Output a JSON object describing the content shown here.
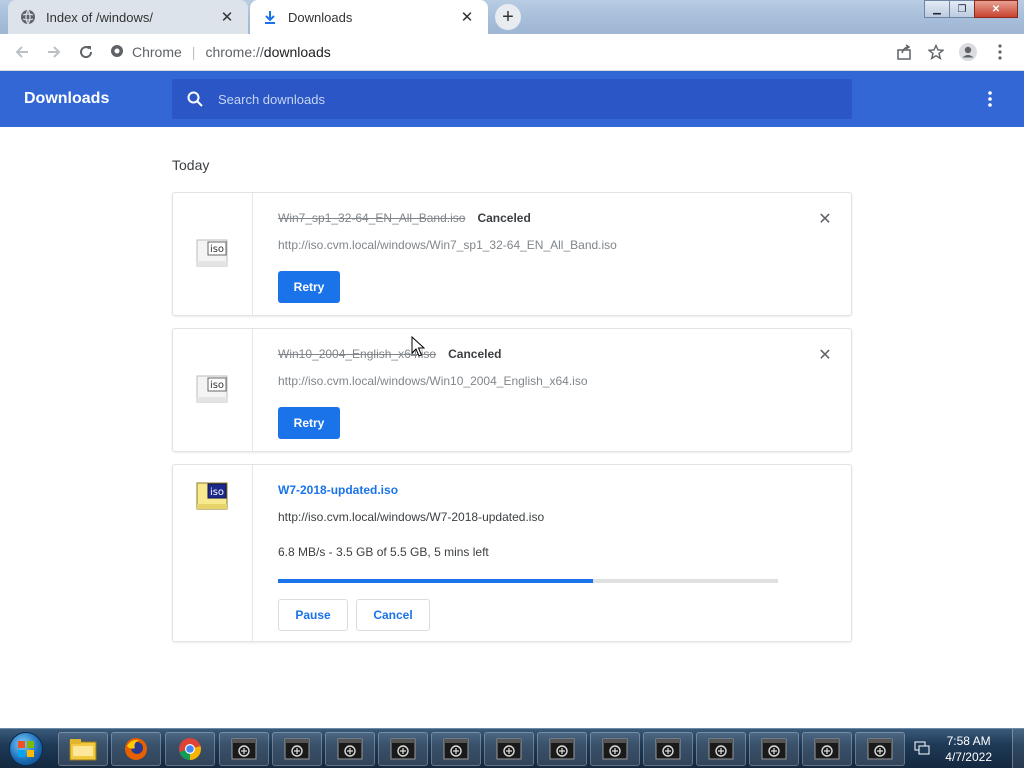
{
  "tabs": [
    {
      "title": "Index of /windows/",
      "icon": "globe-icon",
      "active": false
    },
    {
      "title": "Downloads",
      "icon": "download-icon",
      "active": true
    }
  ],
  "address_bar": {
    "site_label": "Chrome",
    "url_scheme": "chrome://",
    "url_path": "downloads"
  },
  "header": {
    "title": "Downloads",
    "search_placeholder": "Search downloads"
  },
  "section": {
    "label": "Today"
  },
  "downloads": [
    {
      "filename": "Win7_sp1_32-64_EN_All_Band.iso",
      "status": "Canceled",
      "url": "http://iso.cvm.local/windows/Win7_sp1_32-64_EN_All_Band.iso",
      "action": "Retry"
    },
    {
      "filename": "Win10_2004_English_x64.iso",
      "status": "Canceled",
      "url": "http://iso.cvm.local/windows/Win10_2004_English_x64.iso",
      "action": "Retry"
    },
    {
      "filename": "W7-2018-updated.iso",
      "url": "http://iso.cvm.local/windows/W7-2018-updated.iso",
      "progress_text": "6.8 MB/s - 3.5 GB of 5.5 GB, 5 mins left",
      "progress_fraction": 0.63,
      "pause_label": "Pause",
      "cancel_label": "Cancel"
    }
  ],
  "taskbar": {
    "time": "7:58 AM",
    "date": "4/7/2022",
    "pinned": [
      "file-explorer-icon",
      "firefox-icon",
      "chrome-icon"
    ],
    "window_count": 13
  },
  "colors": {
    "header_blue": "#3367d6",
    "search_blue": "#2a56c6",
    "accent": "#1a73e8"
  }
}
